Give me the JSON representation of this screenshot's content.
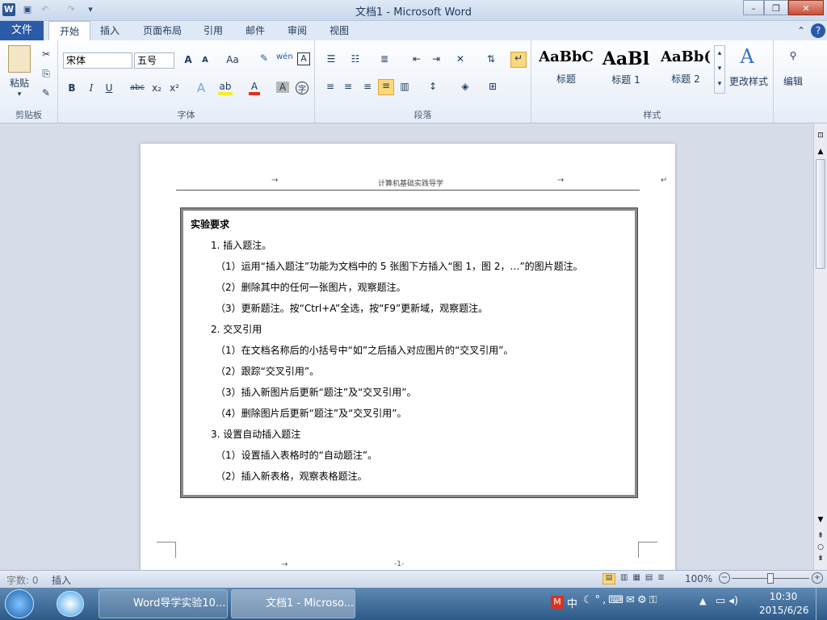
{
  "window": {
    "title": "文档1 - Microsoft Word",
    "app_icon": "W"
  },
  "tabs": {
    "file": "文件",
    "items": [
      "开始",
      "插入",
      "页面布局",
      "引用",
      "邮件",
      "审阅",
      "视图"
    ]
  },
  "ribbon": {
    "clipboard": {
      "paste": "粘贴",
      "label": "剪贴板"
    },
    "font": {
      "name": "宋体",
      "size": "五号",
      "label": "字体",
      "grow": "A",
      "shrink": "A",
      "case": "Aa",
      "bold": "B",
      "italic": "I",
      "underline": "U",
      "strike": "abc",
      "sub": "x₂",
      "sup": "x²"
    },
    "paragraph": {
      "label": "段落"
    },
    "styles": {
      "label": "样式",
      "items": [
        {
          "sample": "AaBbC",
          "name": "标题"
        },
        {
          "sample": "AaBl",
          "name": "标题 1"
        },
        {
          "sample": "AaBb(",
          "name": "标题 2"
        }
      ],
      "change": "更改样式"
    },
    "edit": {
      "label": "编辑"
    }
  },
  "document": {
    "header": "计算机基础实践导学",
    "box_title": "实验要求",
    "lines": [
      "1. 插入题注。",
      "（1）运用“插入题注”功能为文档中的 5 张图下方插入“图 1，图 2，…”的图片题注。",
      "（2）删除其中的任何一张图片，观察题注。",
      "（3）更新题注。按“Ctrl+A”全选，按“F9”更新域，观察题注。",
      "2. 交叉引用",
      "（1）在文档名称后的小括号中“如”之后插入对应图片的“交叉引用”。",
      "（2）跟踪“交叉引用”。",
      "（3）插入新图片后更新“题注”及“交叉引用”。",
      "（4）删除图片后更新“题注”及“交叉引用”。",
      "3. 设置自动插入题注",
      "（1）设置插入表格时的“自动题注”。",
      "（2）插入新表格，观察表格题注。"
    ],
    "footer": "-1-"
  },
  "status": {
    "words": "字数: 0",
    "mode": "插入",
    "zoom": "100%"
  },
  "taskbar": {
    "items": [
      "Word导学实验10...",
      "文档1 - Microso..."
    ],
    "ime": "中",
    "time": "10:30",
    "date": "2015/6/26"
  }
}
